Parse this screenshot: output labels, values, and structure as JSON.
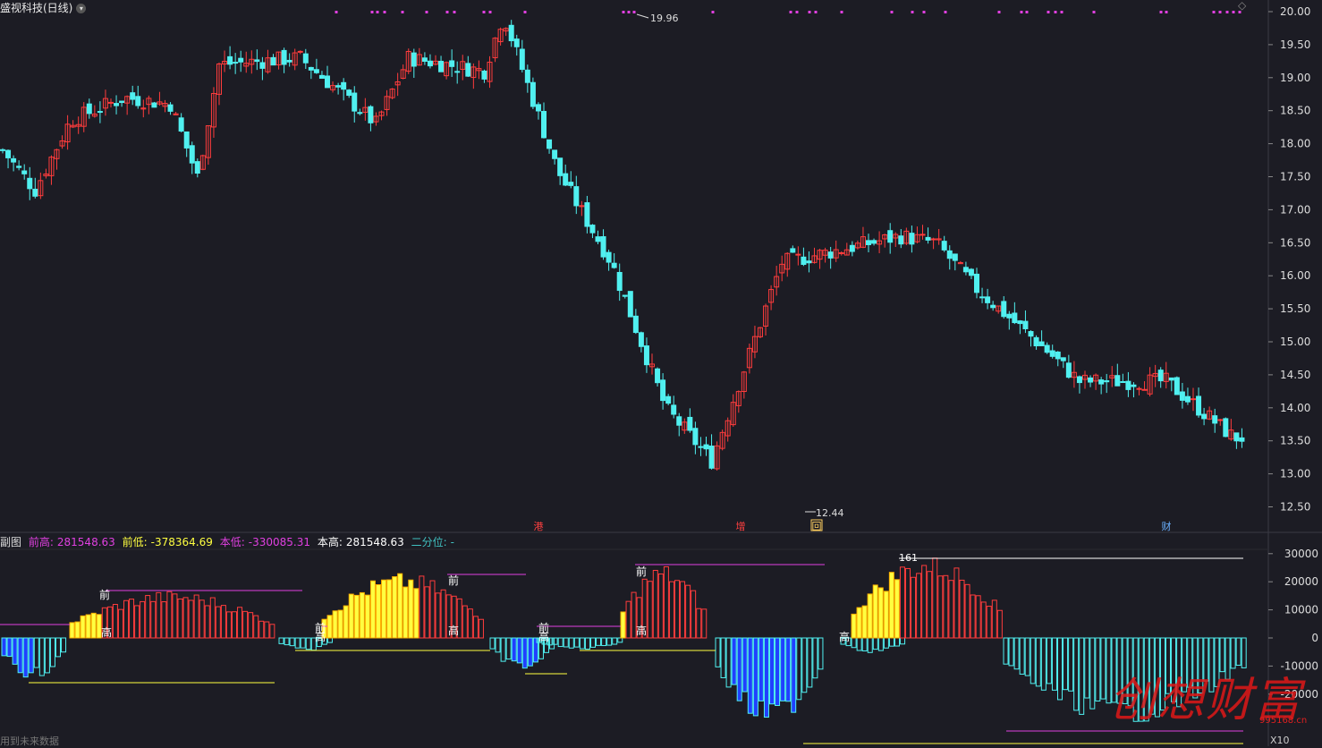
{
  "title": "盛视科技(日线)",
  "main": {
    "y_ticks": [
      "20.00",
      "19.50",
      "19.00",
      "18.50",
      "18.00",
      "17.50",
      "17.00",
      "16.50",
      "16.00",
      "15.50",
      "15.00",
      "14.50",
      "14.00",
      "13.50",
      "13.00",
      "12.50"
    ],
    "high_label": "19.96",
    "low_label": "12.44",
    "event_markers": [
      {
        "text": "港",
        "color": "#ff4040"
      },
      {
        "text": "增",
        "color": "#ff4040"
      },
      {
        "text": "回",
        "color": "#ffd060"
      },
      {
        "text": "财",
        "color": "#6ab0ff"
      }
    ]
  },
  "sub": {
    "name": "副图",
    "qian_gao_label": "前高:",
    "qian_gao_value": "281548.63",
    "qian_di_label": "前低:",
    "qian_di_value": "-378364.69",
    "ben_di_label": "本低:",
    "ben_di_value": "-330085.31",
    "ben_gao_label": "本高:",
    "ben_gao_value": "281548.63",
    "erfen_label": "二分位:",
    "erfen_value": "-",
    "y_ticks": [
      "30000",
      "20000",
      "10000",
      "0",
      "-10000",
      "-20000"
    ],
    "peak_label": "161",
    "bar_labels": [
      "前",
      "高"
    ]
  },
  "footer": {
    "future_data": "用到未来数据",
    "zoom": "X10"
  },
  "watermark": {
    "text": "创想财富",
    "url": "995168.cn"
  },
  "colors": {
    "up": "#ff3c3c",
    "down": "#50f0f0",
    "magenta": "#e040e0",
    "yellow": "#ffff40",
    "blue": "#2040ff"
  }
}
